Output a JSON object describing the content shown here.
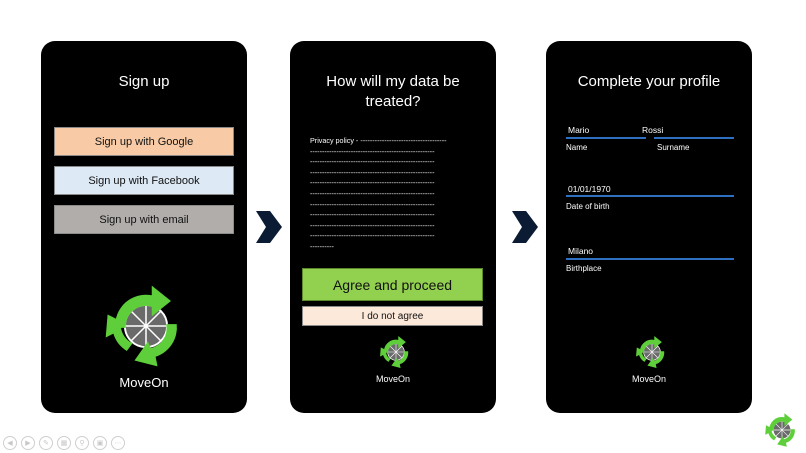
{
  "screen1": {
    "title": "Sign up",
    "google_label": "Sign up with Google",
    "facebook_label": "Sign up with Facebook",
    "email_label": "Sign up with email",
    "brand": "MoveOn"
  },
  "screen2": {
    "title_line1": "How will my data be",
    "title_line2": "treated?",
    "policy_text": "Privacy policy - ------------------------------------\n----------------------------------------------------\n----------------------------------------------------\n----------------------------------------------------\n----------------------------------------------------\n----------------------------------------------------\n----------------------------------------------------\n----------------------------------------------------\n----------------------------------------------------\n----------------------------------------------------\n----------",
    "agree_label": "Agree and proceed",
    "disagree_label": "I do not agree",
    "brand": "MoveOn"
  },
  "screen3": {
    "title": "Complete your profile",
    "name_value": "Mario",
    "surname_value": "Rossi",
    "name_label": "Name",
    "surname_label": "Surname",
    "dob_value": "01/01/1970",
    "dob_label": "Date of birth",
    "birthplace_value": "Milano",
    "birthplace_label": "Birthplace",
    "brand": "MoveOn"
  },
  "colors": {
    "phone_bg": "#000000",
    "google_btn": "#f8cba6",
    "facebook_btn": "#dde9f5",
    "email_btn": "#b0adab",
    "agree_btn": "#92d050",
    "disagree_btn": "#fde9d9",
    "field_underline": "#2f6fc0",
    "logo_green": "#5ecf3a",
    "arrow_fill": "#0b1b33"
  },
  "icons": {
    "flow_arrow": "chevron-right-arrow-icon",
    "logo": "recycle-arrows-logo-icon",
    "toolbar": [
      "back-icon",
      "forward-icon",
      "pen-icon",
      "slides-icon",
      "zoom-icon",
      "subtitles-icon",
      "more-icon"
    ]
  }
}
